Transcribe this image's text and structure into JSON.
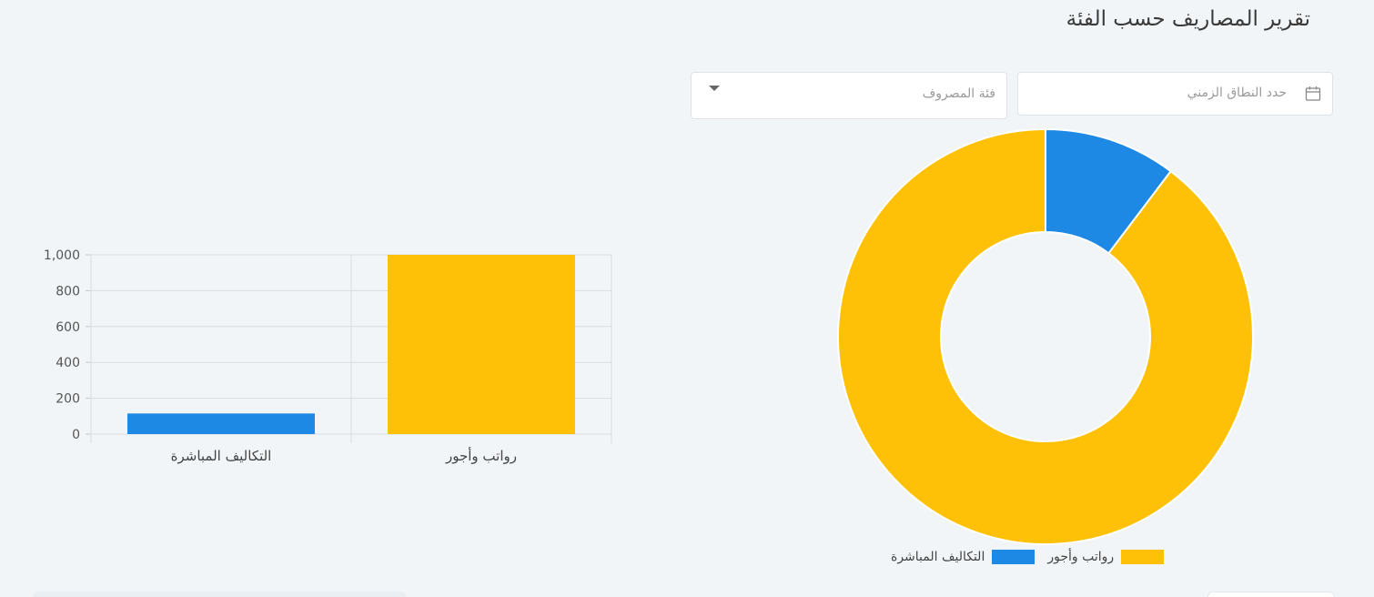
{
  "page": {
    "title": "تقرير المصاريف حسب الفئة"
  },
  "filters": {
    "date_range_placeholder": "حدد النطاق الزمني",
    "category_placeholder": "فئة المصروف",
    "date_icon": "calendar-icon",
    "category_icon": "caret-down-icon"
  },
  "colors": {
    "blue": "#1e88e5",
    "yellow": "#ffc107"
  },
  "chart_data": [
    {
      "type": "bar",
      "categories": [
        "التكاليف المباشرة",
        "رواتب وأجور"
      ],
      "values": [
        115,
        1000
      ],
      "colors": [
        "#1e88e5",
        "#ffc107"
      ],
      "ylim": [
        0,
        1000
      ],
      "yticks": [
        0,
        200,
        400,
        600,
        800,
        1000
      ],
      "ytick_labels": [
        "0",
        "200",
        "400",
        "600",
        "800",
        "1,000"
      ],
      "grid": true
    },
    {
      "type": "pie",
      "donut": true,
      "labels": [
        "التكاليف المباشرة",
        "رواتب وأجور"
      ],
      "values": [
        115,
        1000
      ],
      "colors": [
        "#1e88e5",
        "#ffc107"
      ],
      "legend": [
        {
          "label": "رواتب وأجور",
          "color": "#ffc107"
        },
        {
          "label": "التكاليف المباشرة",
          "color": "#1e88e5"
        }
      ],
      "legend_position": "bottom"
    }
  ]
}
